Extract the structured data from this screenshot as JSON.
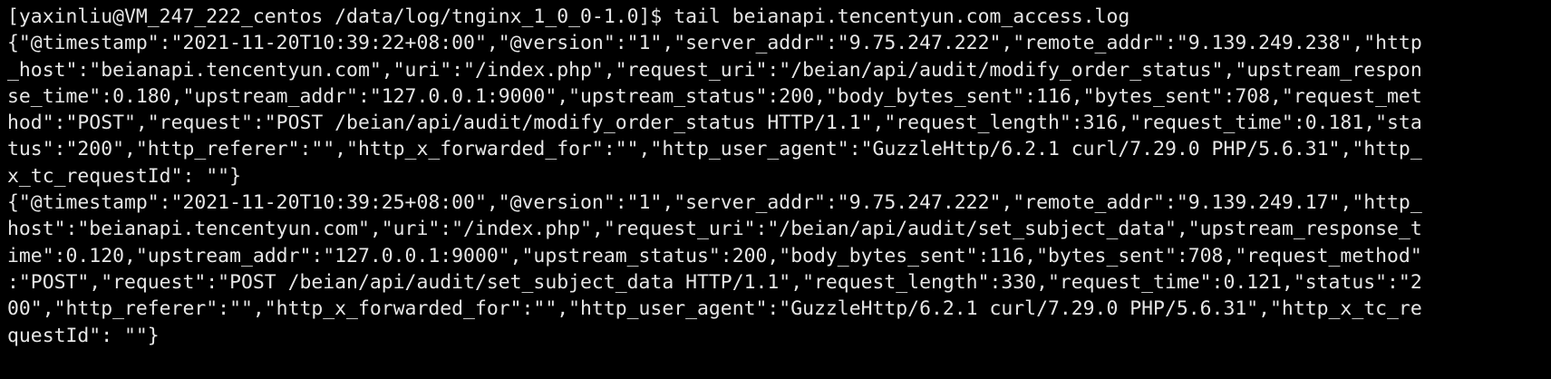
{
  "terminal": {
    "background": "#000000",
    "foreground": "#e6e6e6",
    "lines": [
      "[yaxinliu@VM_247_222_centos /data/log/tnginx_1_0_0-1.0]$ tail beianapi.tencentyun.com_access.log",
      "{\"@timestamp\":\"2021-11-20T10:39:22+08:00\",\"@version\":\"1\",\"server_addr\":\"9.75.247.222\",\"remote_addr\":\"9.139.249.238\",\"http",
      "_host\":\"beianapi.tencentyun.com\",\"uri\":\"/index.php\",\"request_uri\":\"/beian/api/audit/modify_order_status\",\"upstream_respon",
      "se_time\":0.180,\"upstream_addr\":\"127.0.0.1:9000\",\"upstream_status\":200,\"body_bytes_sent\":116,\"bytes_sent\":708,\"request_met",
      "hod\":\"POST\",\"request\":\"POST /beian/api/audit/modify_order_status HTTP/1.1\",\"request_length\":316,\"request_time\":0.181,\"sta",
      "tus\":\"200\",\"http_referer\":\"\",\"http_x_forwarded_for\":\"\",\"http_user_agent\":\"GuzzleHttp/6.2.1 curl/7.29.0 PHP/5.6.31\",\"http_",
      "x_tc_requestId\": \"\"}",
      "{\"@timestamp\":\"2021-11-20T10:39:25+08:00\",\"@version\":\"1\",\"server_addr\":\"9.75.247.222\",\"remote_addr\":\"9.139.249.17\",\"http_",
      "host\":\"beianapi.tencentyun.com\",\"uri\":\"/index.php\",\"request_uri\":\"/beian/api/audit/set_subject_data\",\"upstream_response_t",
      "ime\":0.120,\"upstream_addr\":\"127.0.0.1:9000\",\"upstream_status\":200,\"body_bytes_sent\":116,\"bytes_sent\":708,\"request_method\"",
      ":\"POST\",\"request\":\"POST /beian/api/audit/set_subject_data HTTP/1.1\",\"request_length\":330,\"request_time\":0.121,\"status\":\"2",
      "00\",\"http_referer\":\"\",\"http_x_forwarded_for\":\"\",\"http_user_agent\":\"GuzzleHttp/6.2.1 curl/7.29.0 PHP/5.6.31\",\"http_x_tc_re",
      "questId\": \"\"}"
    ]
  }
}
